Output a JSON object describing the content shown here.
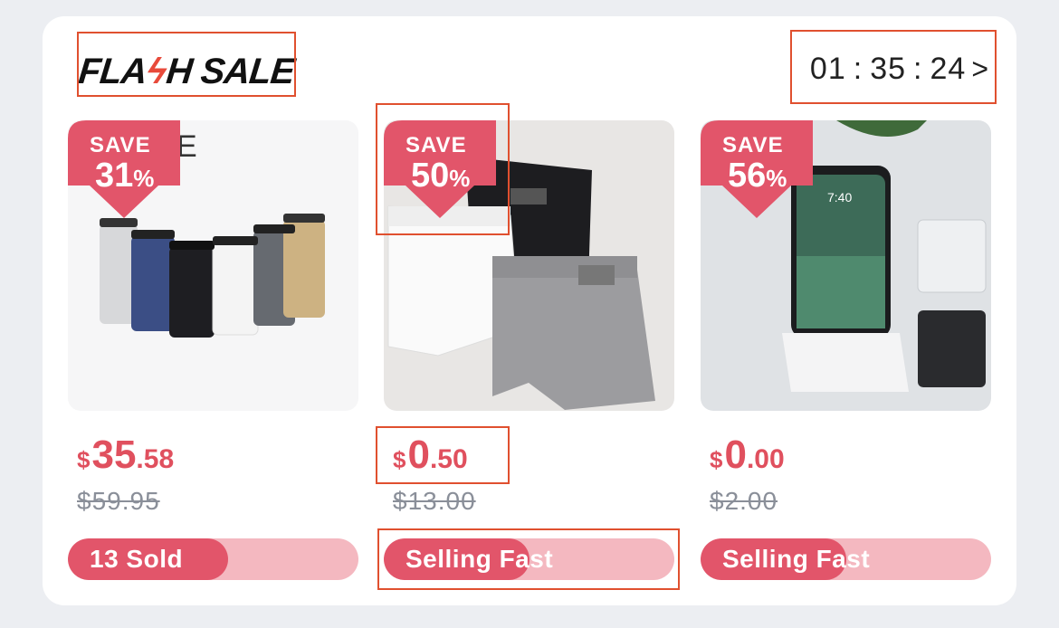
{
  "header": {
    "logo_text_a": "FLA",
    "logo_bolt": "ϟ",
    "logo_text_b": "H SALE",
    "timer": {
      "hours": "01",
      "minutes": "35",
      "seconds": "24",
      "sep": ":",
      "chevron": ">"
    }
  },
  "products": [
    {
      "save_label": "SAVE",
      "save_value": "31",
      "save_unit": "%",
      "currency": "$",
      "price_int": "35",
      "price_dec": ".58",
      "old_price": "$59.95",
      "bar_label": "13 Sold",
      "bar_progress": 0.55
    },
    {
      "save_label": "SAVE",
      "save_value": "50",
      "save_unit": "%",
      "currency": "$",
      "price_int": "0",
      "price_dec": ".50",
      "old_price": "$13.00",
      "bar_label": "Selling Fast",
      "bar_progress": 0.5
    },
    {
      "save_label": "SAVE",
      "save_value": "56",
      "save_unit": "%",
      "currency": "$",
      "price_int": "0",
      "price_dec": ".00",
      "old_price": "$2.00",
      "bar_label": "Selling Fast",
      "bar_progress": 0.5
    }
  ],
  "colors": {
    "accent": "#e0505e",
    "bar_fill": "#e2556a",
    "bar_track": "#f4b8c0"
  }
}
